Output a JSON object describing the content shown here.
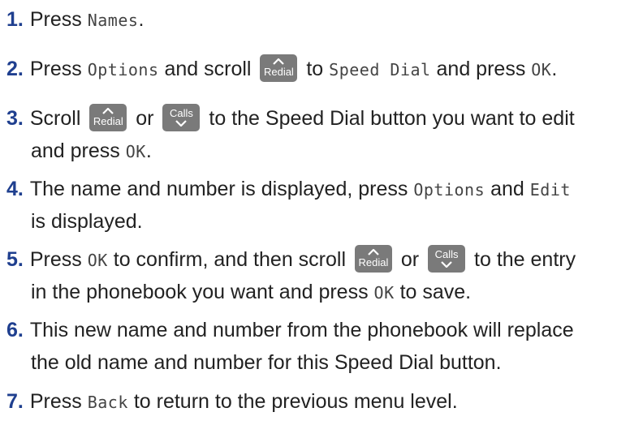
{
  "steps": [
    {
      "num": "1",
      "parts": {
        "a": "Press ",
        "b": "Names",
        "c": "."
      }
    },
    {
      "num": "2",
      "parts": {
        "a": "Press ",
        "b": "Options",
        "c": " and scroll ",
        "d": " to ",
        "e": "Speed Dial",
        "f": " and press ",
        "g": "OK",
        "h": "."
      }
    },
    {
      "num": "3",
      "parts": {
        "a": "Scroll ",
        "b": " or ",
        "c": " to the Speed Dial button you want to edit",
        "d": "and press ",
        "e": "OK",
        "f": "."
      }
    },
    {
      "num": "4",
      "parts": {
        "a": "The name and number is displayed, press ",
        "b": "Options",
        "c": " and ",
        "d": "Edit",
        "e": "is displayed."
      }
    },
    {
      "num": "5",
      "parts": {
        "a": "Press ",
        "b": "OK",
        "c": " to confirm, and then scroll ",
        "d": " or ",
        "e": " to the entry",
        "f": "in the phonebook you want and press ",
        "g": "OK",
        "h": " to save."
      }
    },
    {
      "num": "6",
      "parts": {
        "a": "This new name and number from the phonebook will replace",
        "b": "the old name and number for this Speed Dial button."
      }
    },
    {
      "num": "7",
      "parts": {
        "a": "Press ",
        "b": "Back",
        "c": " to return to the previous menu level."
      }
    }
  ],
  "keys": {
    "redial": "Redial",
    "calls": "Calls"
  },
  "icons": {
    "redial": "chevron-up-icon",
    "calls": "chevron-down-icon"
  },
  "colors": {
    "step_number": "#1f3f8f",
    "key_background": "#7a7a7a",
    "body_text": "#222222"
  }
}
